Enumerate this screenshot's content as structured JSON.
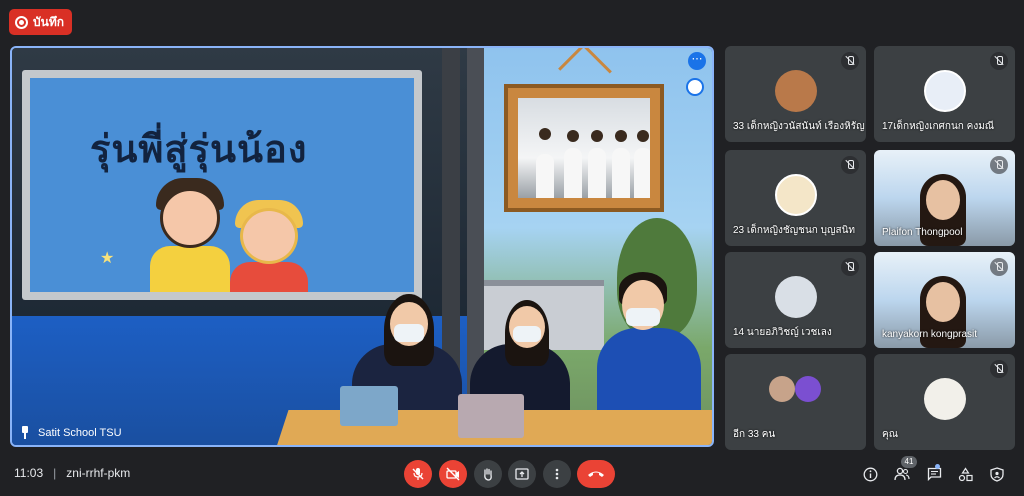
{
  "recording": {
    "label": "บันทึก"
  },
  "main_tile": {
    "name": "Satit School TSU",
    "slide_title": "รุ่นพี่สู่รุ่นน้อง"
  },
  "participants": [
    {
      "name": "33 เด็กหญิงวนัสนันท์ เรืองหิรัญ"
    },
    {
      "name": "17เด็กหญิงเกศกนก คงมณี"
    },
    {
      "name": "23 เด็กหญิงชัญชนก บุญสนิท"
    },
    {
      "name": "Plaifon Thongpool"
    },
    {
      "name": "14 นายอภิวิชญ์ เวชเลง"
    },
    {
      "name": "kanyakorn kongprasit"
    },
    {
      "name": "อีก 33 คน"
    },
    {
      "name": "คุณ"
    }
  ],
  "meeting": {
    "time": "11:03",
    "separator": "|",
    "code": "zni-rrhf-pkm"
  },
  "people_count": "41",
  "colors": {
    "background": "#202124",
    "tile": "#3c4043",
    "accent": "#8ab4f8",
    "danger": "#ea4335"
  },
  "icons": {
    "mic": "mic-off-icon",
    "camera": "camera-off-icon",
    "hand": "raise-hand-icon",
    "present": "present-icon",
    "more": "more-options-icon",
    "end": "end-call-icon",
    "info": "info-icon",
    "people": "people-icon",
    "chat": "chat-icon",
    "activities": "activities-icon",
    "host": "host-controls-icon"
  }
}
